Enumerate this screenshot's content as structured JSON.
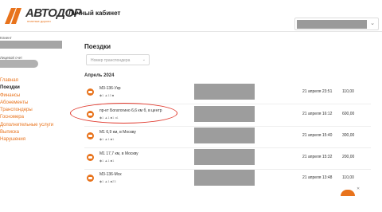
{
  "header": {
    "logo_text": "АВТОДОР",
    "logo_sub": "платные дороги",
    "page_title": "Личный кабинет",
    "user_caret": "⌄"
  },
  "sidebar": {
    "client_label": "Клиент",
    "account_label": "Лицевой счет",
    "items": [
      {
        "label": "Главная"
      },
      {
        "label": "Поездки",
        "active": true
      },
      {
        "label": "Финансы"
      },
      {
        "label": "Абонементы"
      },
      {
        "label": "Транспондеры"
      },
      {
        "label": "Госномера"
      },
      {
        "label": "Дополнительные услуги"
      },
      {
        "label": "Выписка"
      },
      {
        "label": "Нарушения"
      }
    ]
  },
  "main": {
    "section_title": "Поездки",
    "select_placeholder": "Номер транспондера",
    "select_caret": "⌄",
    "month": "Апрель 2024",
    "trips": [
      {
        "name": "М3-136-Укр",
        "meta": "◆1 ▲13 ■",
        "date": "21 апреля 23:51",
        "sum": "110,00"
      },
      {
        "name": "пр-кт Богатогино 6,6 км б, в центр",
        "meta": "◆1 ▲1 ■1 ◂1",
        "date": "21 апреля 16:12",
        "sum": "600,00"
      },
      {
        "name": "М1 6,9 км, в Москву",
        "meta": "◆1 ▲1 ■1",
        "date": "21 апреля 15:40",
        "sum": "300,00"
      },
      {
        "name": "М1 17,7 км, в Москву",
        "meta": "◆1 ▲1 ■1",
        "date": "21 апреля 15:32",
        "sum": "200,00"
      },
      {
        "name": "М3-136-Мск",
        "meta": "◆1 ▲1 ■23",
        "date": "21 апреля 13:48",
        "sum": "110,00"
      }
    ]
  },
  "widget": {
    "close": "✕"
  }
}
